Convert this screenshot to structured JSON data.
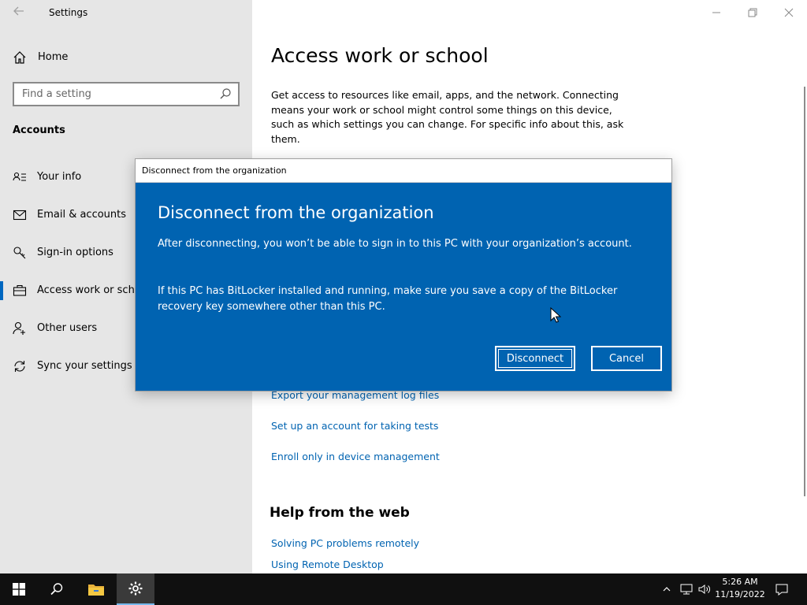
{
  "window": {
    "title": "Settings",
    "back_icon": "back-arrow-icon",
    "controls": {
      "minimize": "minimize-icon",
      "maximize": "restore-icon",
      "close": "close-icon"
    }
  },
  "sidebar": {
    "home_label": "Home",
    "search_placeholder": "Find a setting",
    "section_label": "Accounts",
    "items": [
      {
        "label": "Your info",
        "icon": "person-card-icon",
        "active": false
      },
      {
        "label": "Email & accounts",
        "icon": "mail-icon",
        "active": false
      },
      {
        "label": "Sign-in options",
        "icon": "key-icon",
        "active": false
      },
      {
        "label": "Access work or scho",
        "icon": "briefcase-icon",
        "active": true
      },
      {
        "label": "Other users",
        "icon": "person-add-icon",
        "active": false
      },
      {
        "label": "Sync your settings",
        "icon": "sync-icon",
        "active": false
      }
    ]
  },
  "main": {
    "title": "Access work or school",
    "description": "Get access to resources like email, apps, and the network. Connecting means your work or school might control some things on this device, such as which settings you can change. For specific info about this, ask them.",
    "links": [
      "Export your management log files",
      "Set up an account for taking tests",
      "Enroll only in device management"
    ],
    "help_heading": "Help from the web",
    "help_links": [
      "Solving PC problems remotely",
      "Using Remote Desktop"
    ]
  },
  "dialog": {
    "window_title": "Disconnect from the organization",
    "heading": "Disconnect from the organization",
    "paragraph1": "After disconnecting, you won’t be able to sign in to this PC with your organization’s account.",
    "paragraph2": "If this PC has BitLocker installed and running, make sure you save a copy of the BitLocker recovery key somewhere other than this PC.",
    "disconnect_label": "Disconnect",
    "cancel_label": "Cancel",
    "accent_color": "#0063b1"
  },
  "taskbar": {
    "time": "5:26 AM",
    "date": "11/19/2022",
    "icons": [
      "windows-start-icon",
      "search-icon",
      "file-explorer-icon",
      "settings-gear-icon"
    ],
    "tray_icons": [
      "chevron-up-icon",
      "network-icon",
      "volume-icon",
      "notification-icon"
    ]
  }
}
